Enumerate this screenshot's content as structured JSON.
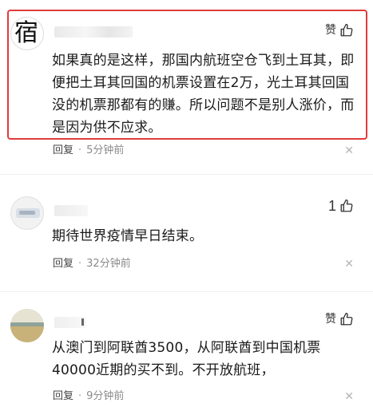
{
  "comments": [
    {
      "avatar_glyph": "宿",
      "username": "",
      "like_label": "赞",
      "like_count": "",
      "text": "如果真的是这样，那国内航班空仓飞到土耳其，即便把土耳其回国的机票设置在2万，光土耳其回国没的机票那都有的赚。所以问题不是别人涨价，而是因为供不应求。",
      "reply_label": "回复",
      "separator": "·",
      "time": "5分钟前",
      "close_glyph": "✕",
      "highlighted": true
    },
    {
      "avatar_glyph": "",
      "username": "",
      "like_label": "",
      "like_count": "1",
      "text": "期待世界疫情早日结束。",
      "reply_label": "回复",
      "separator": "·",
      "time": "32分钟前",
      "close_glyph": "✕",
      "highlighted": false
    },
    {
      "avatar_glyph": "",
      "username": "",
      "like_label": "赞",
      "like_count": "",
      "text": "从澳门到阿联酋3500，从阿联酋到中国机票40000近期的买不到。不开放航班，",
      "reply_label": "回复",
      "separator": "·",
      "time": "9分钟前",
      "close_glyph": "✕",
      "highlighted": false
    }
  ],
  "icons": {
    "like": "thumbs-up-icon",
    "close": "close-icon"
  },
  "colors": {
    "highlight_border": "#e23b3b",
    "meta_text": "#8a8a8a",
    "close_icon": "#b5b5b5"
  }
}
